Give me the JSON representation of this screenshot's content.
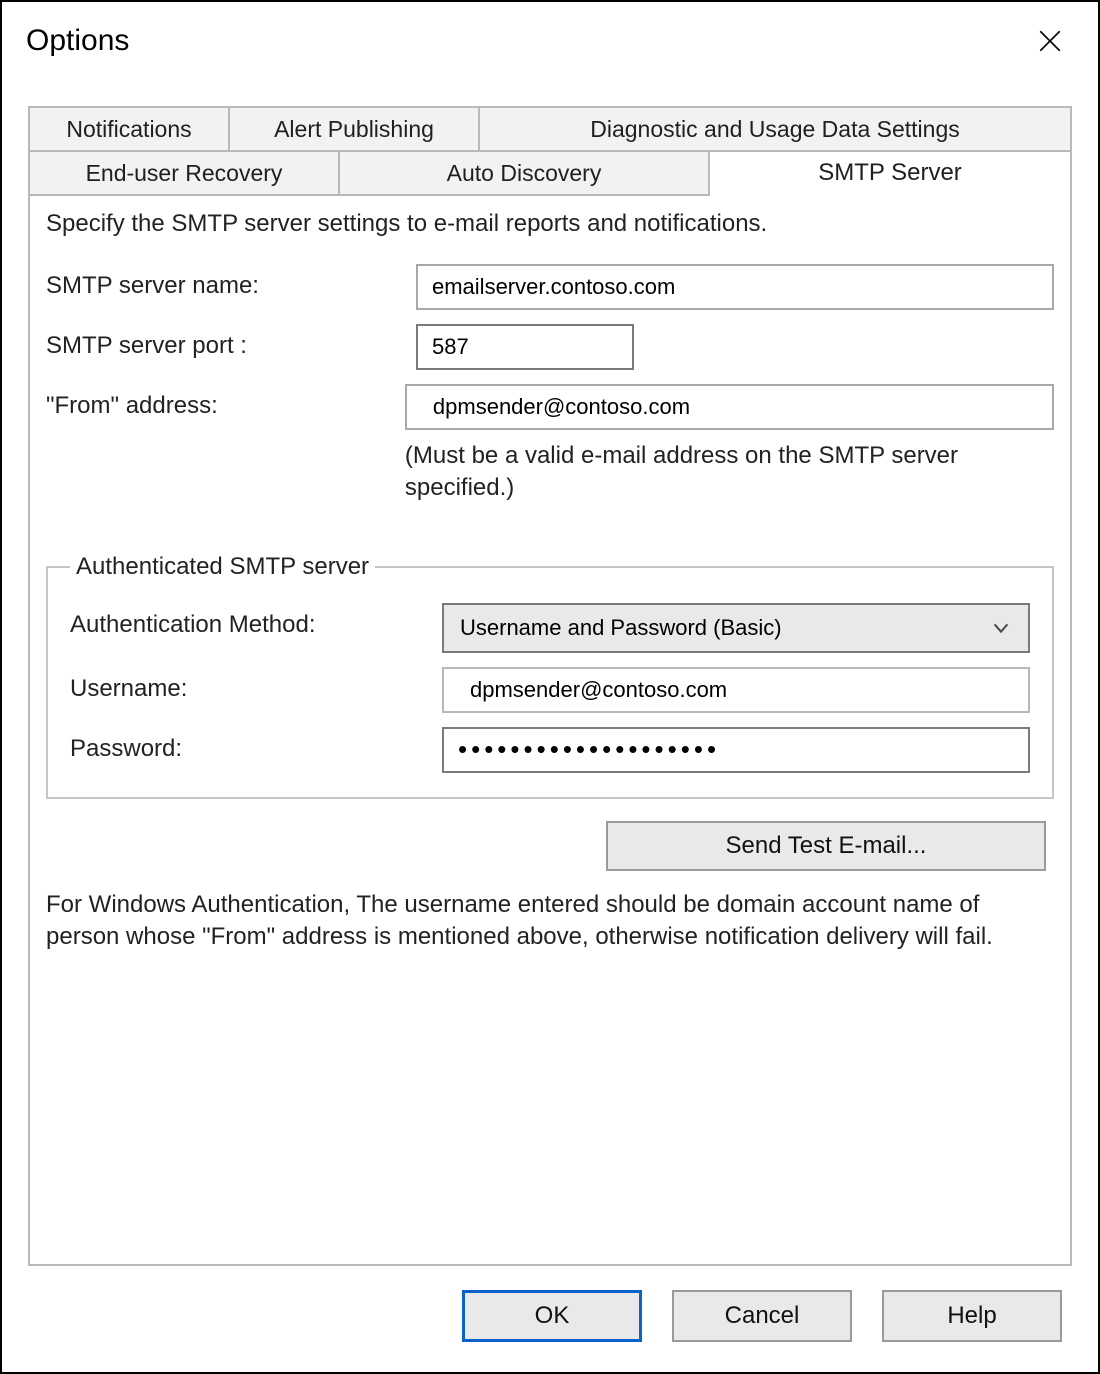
{
  "window": {
    "title": "Options"
  },
  "tabs": {
    "row1": {
      "notifications": "Notifications",
      "alert_publishing": "Alert Publishing",
      "diagnostic": "Diagnostic and Usage Data Settings"
    },
    "row2": {
      "end_user_recovery": "End-user Recovery",
      "auto_discovery": "Auto Discovery",
      "smtp_server": "SMTP Server"
    },
    "selected": "smtp_server"
  },
  "panel": {
    "intro": "Specify the SMTP server settings to e-mail reports and notifications.",
    "server_name_label": "SMTP server name:",
    "server_name_value": "emailserver.contoso.com",
    "server_port_label": "SMTP server port :",
    "server_port_value": "587",
    "from_label": "\"From\" address:",
    "from_value": "dpmsender@contoso.com",
    "from_helper": "(Must be a valid e-mail address on the SMTP server specified.)",
    "auth": {
      "legend": "Authenticated SMTP server",
      "method_label": "Authentication Method:",
      "method_value": "Username and Password (Basic)",
      "username_label": "Username:",
      "username_value": "dpmsender@contoso.com",
      "password_label": "Password:",
      "password_value": "••••••••••••••••••••"
    },
    "send_test_label": "Send Test E-mail...",
    "note": "For Windows Authentication, The username entered should be domain account name of person whose \"From\" address is mentioned above, otherwise notification delivery will fail."
  },
  "buttons": {
    "ok": "OK",
    "cancel": "Cancel",
    "help": "Help"
  }
}
